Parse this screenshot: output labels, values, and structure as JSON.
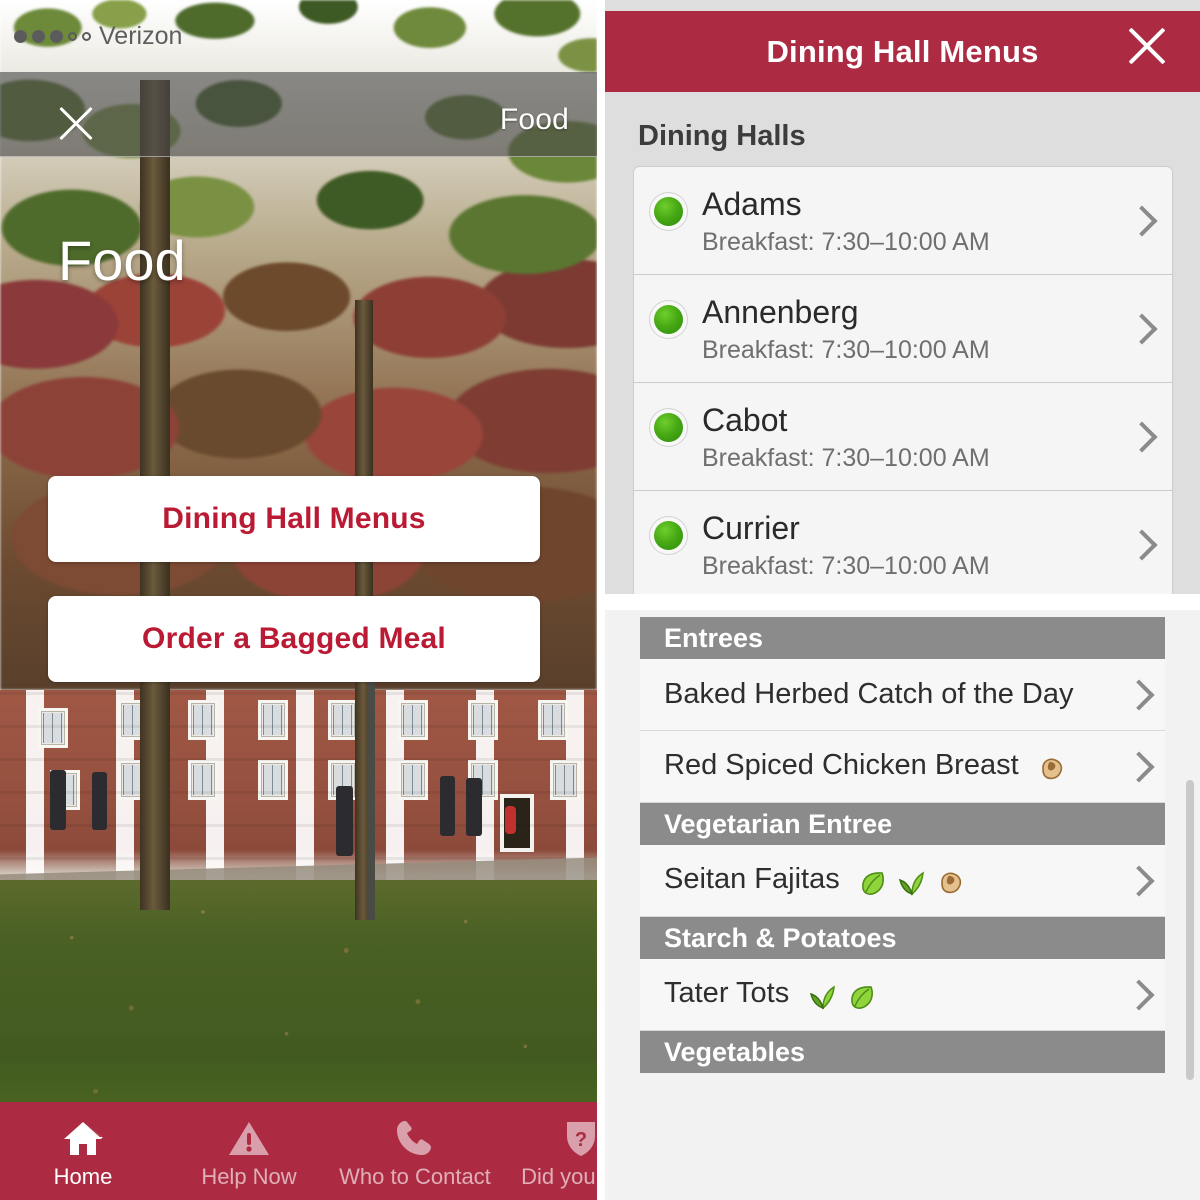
{
  "left_phone": {
    "status_bar": {
      "signal_dots": "●●●○○",
      "carrier": "Verizon"
    },
    "nav": {
      "close_icon": "close-x-icon",
      "title": "Food"
    },
    "hero_title": "Food",
    "buttons": [
      {
        "label": "Dining Hall Menus"
      },
      {
        "label": "Order a Bagged Meal"
      }
    ],
    "tabbar": [
      {
        "label": "Home",
        "icon": "home-icon",
        "active": true
      },
      {
        "label": "Help Now",
        "icon": "warning-triangle-icon",
        "active": false
      },
      {
        "label": "Who to Contact",
        "icon": "phone-icon",
        "active": false
      },
      {
        "label": "Did you Kno",
        "icon": "shield-question-icon",
        "active": false
      }
    ],
    "accent_color": "#AC2B43",
    "button_text_color": "#BA1A33"
  },
  "right_top": {
    "header_title": "Dining Hall Menus",
    "close_icon": "close-x-icon",
    "section_label": "Dining Halls",
    "halls": [
      {
        "name": "Adams",
        "hours": "Breakfast: 7:30–10:00 AM",
        "status": "open"
      },
      {
        "name": "Annenberg",
        "hours": "Breakfast: 7:30–10:00 AM",
        "status": "open"
      },
      {
        "name": "Cabot",
        "hours": "Breakfast: 7:30–10:00 AM",
        "status": "open"
      },
      {
        "name": "Currier",
        "hours": "Breakfast: 7:30–10:00 AM",
        "status": "open"
      }
    ],
    "status_dot_color": "#46A914"
  },
  "right_bottom": {
    "sections": [
      {
        "heading": "Entrees",
        "items": [
          {
            "name": "Baked Herbed Catch of the Day",
            "tags": []
          },
          {
            "name": "Red Spiced Chicken Breast",
            "tags": [
              "peanut-allergen-icon"
            ]
          }
        ]
      },
      {
        "heading": "Vegetarian Entree",
        "items": [
          {
            "name": "Seitan Fajitas",
            "tags": [
              "leaf-vegetarian-icon",
              "seedling-vegan-icon",
              "peanut-allergen-icon"
            ]
          }
        ]
      },
      {
        "heading": "Starch & Potatoes",
        "items": [
          {
            "name": "Tater Tots",
            "tags": [
              "seedling-vegan-icon",
              "leaf-vegetarian-icon"
            ]
          }
        ]
      },
      {
        "heading": "Vegetables",
        "items": []
      }
    ],
    "header_bg_color": "#8B8B8B"
  }
}
